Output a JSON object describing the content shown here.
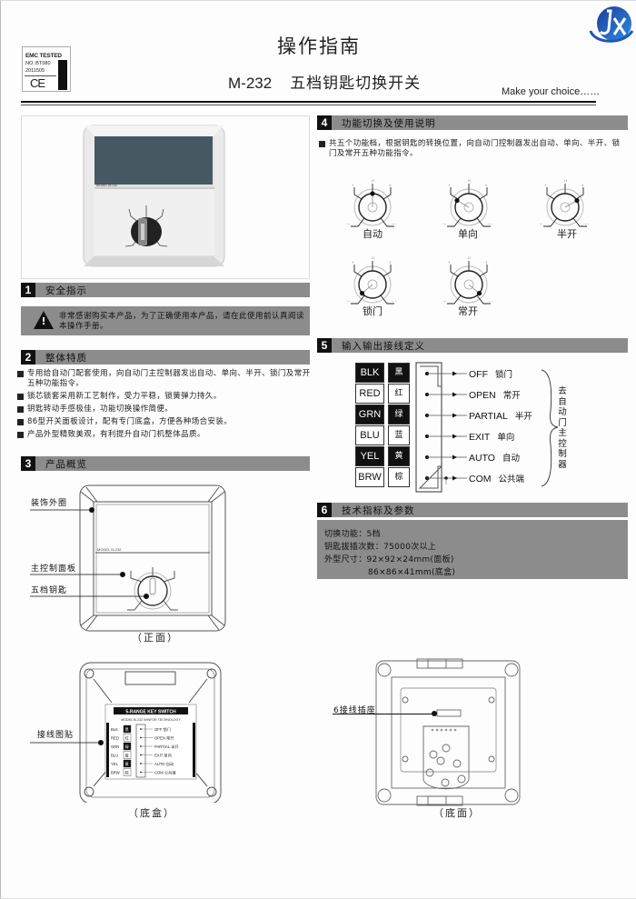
{
  "header": {
    "title": "操作指南",
    "model": "M-232",
    "product_name": "五档钥匙切换开关",
    "slogan": "Make your choice……",
    "logo": "JX-logo-icon",
    "logo_colors": [
      "#1a3f9c",
      "#2f7fd8"
    ],
    "cert_badge": {
      "line1": "EMC TESTED",
      "line2": "NO.:BT080",
      "line3": "2011505",
      "mark": "CE"
    }
  },
  "sections": {
    "s1": {
      "num": "1",
      "title": "安全指示",
      "warning": "非常感谢购买本产品，为了正确使用本产品，请在此使用前认真阅读本操作手册。"
    },
    "s2": {
      "num": "2",
      "title": "整体特质",
      "features": [
        "专用给自动门配套使用，向自动门主控制器发出自动、单向、半开、锁门及常开五种功能指令。",
        "锁芯锁套采用新工艺制作，受力平稳，锁簧弹力持久。",
        "钥匙转动手感极佳，功能切换操作简便。",
        "86型开关面板设计，配有专门底盒，方便各种场合安装。",
        "产品外型精致美观，有利提升自动门机整体品质。"
      ]
    },
    "s3": {
      "num": "3",
      "title": "产品概览",
      "front_callouts": [
        "装饰外圈",
        "主控制面板",
        "五档钥匙"
      ],
      "front_model_text": "MODEL M-232",
      "front_caption": "（正面）",
      "box_callout": "接线图贴",
      "box_caption": "（底盒）",
      "box_sticker": {
        "title": "5-RANGE KEY SWITCH",
        "subtitle": "MODEL M-232    WINFOR TECHNOLOGY"
      },
      "back_callout": "6接线插座",
      "back_caption": "（底面）"
    },
    "s4": {
      "num": "4",
      "title": "功能切换及使用说明",
      "intro": "共五个功能档，根据钥匙的转换位置，向自动门控制器发出自动、单向、半开、锁门及常开五种功能指令。",
      "positions": [
        {
          "label": "自动",
          "pointer": "top"
        },
        {
          "label": "单向",
          "pointer": "upper-left"
        },
        {
          "label": "半开",
          "pointer": "upper-right"
        },
        {
          "label": "锁门",
          "pointer": "lower-left"
        },
        {
          "label": "常开",
          "pointer": "lower-right"
        }
      ]
    },
    "s5": {
      "num": "5",
      "title": "输入输出接线定义",
      "wires": [
        {
          "code": "BLK",
          "cn": "黑",
          "dark": true,
          "signal": "OFF",
          "function": "锁门"
        },
        {
          "code": "RED",
          "cn": "红",
          "dark": false,
          "signal": "OPEN",
          "function": "常开"
        },
        {
          "code": "GRN",
          "cn": "绿",
          "dark": true,
          "signal": "PARTIAL",
          "function": "半开"
        },
        {
          "code": "BLU",
          "cn": "蓝",
          "dark": false,
          "signal": "EXIT",
          "function": "单向"
        },
        {
          "code": "YEL",
          "cn": "黄",
          "dark": true,
          "signal": "AUTO",
          "function": "自动"
        },
        {
          "code": "BRW",
          "cn": "棕",
          "dark": false,
          "signal": "COM",
          "function": "公共端"
        }
      ],
      "destination": "去自动门主控制器"
    },
    "s6": {
      "num": "6",
      "title": "技术指标及参数",
      "specs": [
        "切换功能：5档",
        "钥匙拔插次数：75000次以上",
        "外型尺寸：92×92×24mm(面板)",
        "86×86×41mm(底盒)"
      ]
    }
  },
  "colors": {
    "section_bar": "#8c8c8c",
    "section_num_bg": "#111111",
    "panel_window": "#465862",
    "panel_body": "#e4e4e4"
  }
}
